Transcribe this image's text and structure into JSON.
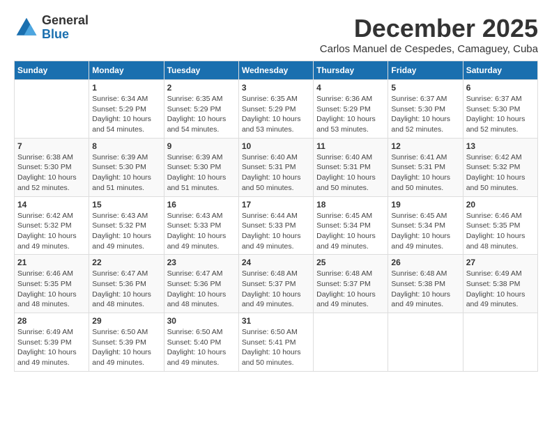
{
  "logo": {
    "general": "General",
    "blue": "Blue"
  },
  "title": "December 2025",
  "subtitle": "Carlos Manuel de Cespedes, Camaguey, Cuba",
  "days_of_week": [
    "Sunday",
    "Monday",
    "Tuesday",
    "Wednesday",
    "Thursday",
    "Friday",
    "Saturday"
  ],
  "weeks": [
    [
      {
        "day": "",
        "content": ""
      },
      {
        "day": "1",
        "content": "Sunrise: 6:34 AM\nSunset: 5:29 PM\nDaylight: 10 hours\nand 54 minutes."
      },
      {
        "day": "2",
        "content": "Sunrise: 6:35 AM\nSunset: 5:29 PM\nDaylight: 10 hours\nand 54 minutes."
      },
      {
        "day": "3",
        "content": "Sunrise: 6:35 AM\nSunset: 5:29 PM\nDaylight: 10 hours\nand 53 minutes."
      },
      {
        "day": "4",
        "content": "Sunrise: 6:36 AM\nSunset: 5:29 PM\nDaylight: 10 hours\nand 53 minutes."
      },
      {
        "day": "5",
        "content": "Sunrise: 6:37 AM\nSunset: 5:30 PM\nDaylight: 10 hours\nand 52 minutes."
      },
      {
        "day": "6",
        "content": "Sunrise: 6:37 AM\nSunset: 5:30 PM\nDaylight: 10 hours\nand 52 minutes."
      }
    ],
    [
      {
        "day": "7",
        "content": "Sunrise: 6:38 AM\nSunset: 5:30 PM\nDaylight: 10 hours\nand 52 minutes."
      },
      {
        "day": "8",
        "content": "Sunrise: 6:39 AM\nSunset: 5:30 PM\nDaylight: 10 hours\nand 51 minutes."
      },
      {
        "day": "9",
        "content": "Sunrise: 6:39 AM\nSunset: 5:30 PM\nDaylight: 10 hours\nand 51 minutes."
      },
      {
        "day": "10",
        "content": "Sunrise: 6:40 AM\nSunset: 5:31 PM\nDaylight: 10 hours\nand 50 minutes."
      },
      {
        "day": "11",
        "content": "Sunrise: 6:40 AM\nSunset: 5:31 PM\nDaylight: 10 hours\nand 50 minutes."
      },
      {
        "day": "12",
        "content": "Sunrise: 6:41 AM\nSunset: 5:31 PM\nDaylight: 10 hours\nand 50 minutes."
      },
      {
        "day": "13",
        "content": "Sunrise: 6:42 AM\nSunset: 5:32 PM\nDaylight: 10 hours\nand 50 minutes."
      }
    ],
    [
      {
        "day": "14",
        "content": "Sunrise: 6:42 AM\nSunset: 5:32 PM\nDaylight: 10 hours\nand 49 minutes."
      },
      {
        "day": "15",
        "content": "Sunrise: 6:43 AM\nSunset: 5:32 PM\nDaylight: 10 hours\nand 49 minutes."
      },
      {
        "day": "16",
        "content": "Sunrise: 6:43 AM\nSunset: 5:33 PM\nDaylight: 10 hours\nand 49 minutes."
      },
      {
        "day": "17",
        "content": "Sunrise: 6:44 AM\nSunset: 5:33 PM\nDaylight: 10 hours\nand 49 minutes."
      },
      {
        "day": "18",
        "content": "Sunrise: 6:45 AM\nSunset: 5:34 PM\nDaylight: 10 hours\nand 49 minutes."
      },
      {
        "day": "19",
        "content": "Sunrise: 6:45 AM\nSunset: 5:34 PM\nDaylight: 10 hours\nand 49 minutes."
      },
      {
        "day": "20",
        "content": "Sunrise: 6:46 AM\nSunset: 5:35 PM\nDaylight: 10 hours\nand 48 minutes."
      }
    ],
    [
      {
        "day": "21",
        "content": "Sunrise: 6:46 AM\nSunset: 5:35 PM\nDaylight: 10 hours\nand 48 minutes."
      },
      {
        "day": "22",
        "content": "Sunrise: 6:47 AM\nSunset: 5:36 PM\nDaylight: 10 hours\nand 48 minutes."
      },
      {
        "day": "23",
        "content": "Sunrise: 6:47 AM\nSunset: 5:36 PM\nDaylight: 10 hours\nand 48 minutes."
      },
      {
        "day": "24",
        "content": "Sunrise: 6:48 AM\nSunset: 5:37 PM\nDaylight: 10 hours\nand 49 minutes."
      },
      {
        "day": "25",
        "content": "Sunrise: 6:48 AM\nSunset: 5:37 PM\nDaylight: 10 hours\nand 49 minutes."
      },
      {
        "day": "26",
        "content": "Sunrise: 6:48 AM\nSunset: 5:38 PM\nDaylight: 10 hours\nand 49 minutes."
      },
      {
        "day": "27",
        "content": "Sunrise: 6:49 AM\nSunset: 5:38 PM\nDaylight: 10 hours\nand 49 minutes."
      }
    ],
    [
      {
        "day": "28",
        "content": "Sunrise: 6:49 AM\nSunset: 5:39 PM\nDaylight: 10 hours\nand 49 minutes."
      },
      {
        "day": "29",
        "content": "Sunrise: 6:50 AM\nSunset: 5:39 PM\nDaylight: 10 hours\nand 49 minutes."
      },
      {
        "day": "30",
        "content": "Sunrise: 6:50 AM\nSunset: 5:40 PM\nDaylight: 10 hours\nand 49 minutes."
      },
      {
        "day": "31",
        "content": "Sunrise: 6:50 AM\nSunset: 5:41 PM\nDaylight: 10 hours\nand 50 minutes."
      },
      {
        "day": "",
        "content": ""
      },
      {
        "day": "",
        "content": ""
      },
      {
        "day": "",
        "content": ""
      }
    ]
  ]
}
